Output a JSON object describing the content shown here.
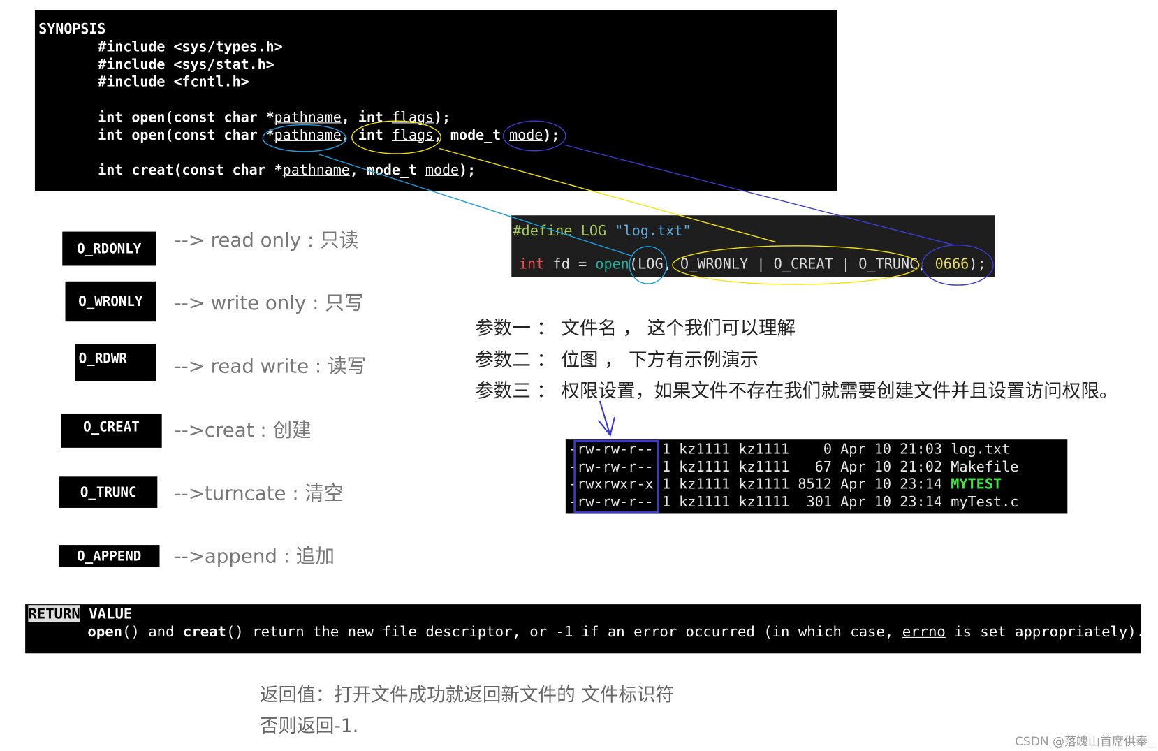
{
  "synopsis": {
    "heading": "SYNOPSIS",
    "includes": [
      "#include <sys/types.h>",
      "#include <sys/stat.h>",
      "#include <fcntl.h>"
    ],
    "open1": {
      "pre": "int open(const char *",
      "p1": "pathname",
      "mid": ", int ",
      "p2": "flags",
      "post": ");"
    },
    "open2": {
      "pre": "int open(const char *",
      "p1": "pathname",
      "mid": ", int ",
      "p2": "flags",
      "mid2": ", mode_t ",
      "p3": "mode",
      "post": ");"
    },
    "creat": {
      "pre": "int creat(const char *",
      "p1": "pathname",
      "mid": ", mode_t ",
      "p2": "mode",
      "post": ");"
    }
  },
  "example_code": {
    "line1": {
      "directive": "#define",
      "name": " LOG ",
      "string": "\"log.txt\""
    },
    "line2": {
      "kw": "int",
      "var": " fd = ",
      "fn": "open",
      "args1": "(LOG, ",
      "flags": "O_WRONLY | O_CREAT | O_TRUNC, ",
      "mode": "0666",
      "end": ");"
    }
  },
  "flags": [
    {
      "name": "O_RDONLY",
      "desc": "--> read only : 只读"
    },
    {
      "name": "O_WRONLY",
      "desc": "--> write only : 只写"
    },
    {
      "name": "O_RDWR",
      "desc": "--> read write : 读写"
    },
    {
      "name": "O_CREAT",
      "desc": "-->creat : 创建"
    },
    {
      "name": "O_TRUNC",
      "desc": "-->turncate : 清空"
    },
    {
      "name": "O_APPEND",
      "desc": "-->append : 追加"
    }
  ],
  "params": [
    "参数一 ： 文件名 ， 这个我们可以理解",
    "参数二 ： 位图 ， 下方有示例演示",
    "参数三 ： 权限设置，如果文件不存在我们就需要创建文件并且设置访问权限。"
  ],
  "ls_rows": [
    {
      "perm": "-rw-rw-r--",
      "rest": " 1 kz1111 kz1111    0 Apr 10 21:03 ",
      "name": "log.txt",
      "exec": false
    },
    {
      "perm": "-rw-rw-r--",
      "rest": " 1 kz1111 kz1111   67 Apr 10 21:02 ",
      "name": "Makefile",
      "exec": false
    },
    {
      "perm": "-rwxrwxr-x",
      "rest": " 1 kz1111 kz1111 8512 Apr 10 23:14 ",
      "name": "MYTEST",
      "exec": true
    },
    {
      "perm": "-rw-rw-r--",
      "rest": " 1 kz1111 kz1111  301 Apr 10 23:14 ",
      "name": "myTest.c",
      "exec": false
    }
  ],
  "return_value": {
    "heading1": "RETURN",
    "heading2": " VALUE",
    "open": "open",
    "t1": "() and ",
    "creat": "creat",
    "t2": "() return the new file descriptor, or -1 if an error occurred (in which case, ",
    "errno": "errno",
    "t3": " is set appropriately)."
  },
  "return_cn": [
    "返回值：打开文件成功就返回新文件的 文件标识符",
    "否则返回-1."
  ],
  "watermark": "CSDN @落魄山首席供奉_",
  "colors": {
    "cyan": "#1a9fe0",
    "yellow": "#f5e600",
    "blue": "#3a3ad0",
    "green_exec": "#3fe33f",
    "define": "#a6c95a",
    "string": "#5fa8d8",
    "keyword": "#f05050",
    "func": "#20b0a0",
    "number": "#e8e060"
  }
}
